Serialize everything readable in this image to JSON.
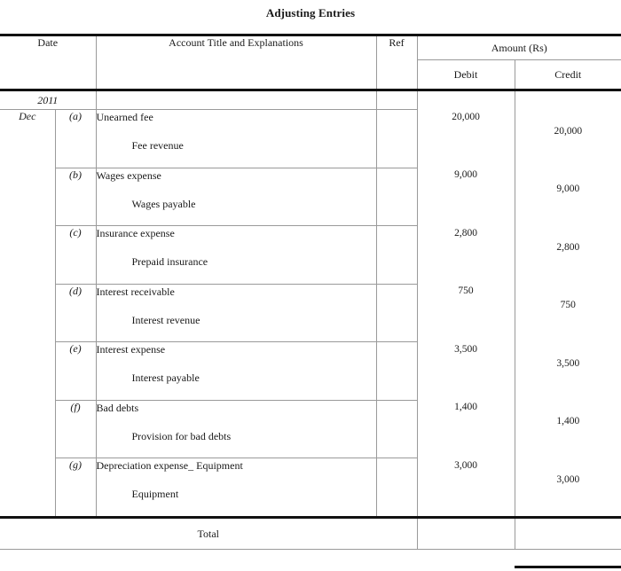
{
  "document": {
    "title": "Adjusting Entries"
  },
  "table": {
    "headers": {
      "date": "Date",
      "account": "Account Title and Explanations",
      "ref": "Ref",
      "amount_group": "Amount (Rs)",
      "debit": "Debit",
      "credit": "Credit"
    },
    "year": "2011",
    "month": "Dec",
    "total_label": "Total",
    "total_debit": "",
    "total_credit": "",
    "entries": [
      {
        "letter": "(a)",
        "debit_account": "Unearned fee",
        "credit_account": "Fee revenue",
        "debit_amount": "20,000",
        "credit_amount": "20,000",
        "ref": ""
      },
      {
        "letter": "(b)",
        "debit_account": "Wages expense",
        "credit_account": "Wages payable",
        "debit_amount": "9,000",
        "credit_amount": "9,000",
        "ref": ""
      },
      {
        "letter": "(c)",
        "debit_account": "Insurance expense",
        "credit_account": "Prepaid insurance",
        "debit_amount": "2,800",
        "credit_amount": "2,800",
        "ref": ""
      },
      {
        "letter": "(d)",
        "debit_account": "Interest receivable",
        "credit_account": "Interest revenue",
        "debit_amount": "750",
        "credit_amount": "750",
        "ref": ""
      },
      {
        "letter": "(e)",
        "debit_account": "Interest expense",
        "credit_account": "Interest payable",
        "debit_amount": "3,500",
        "credit_amount": "3,500",
        "ref": ""
      },
      {
        "letter": "(f)",
        "debit_account": "Bad debts",
        "credit_account": "Provision for bad debts",
        "debit_amount": "1,400",
        "credit_amount": "1,400",
        "ref": ""
      },
      {
        "letter": "(g)",
        "debit_account": "Depreciation expense_ Equipment",
        "credit_account": "Equipment",
        "debit_amount": "3,000",
        "credit_amount": "3,000",
        "ref": ""
      }
    ]
  },
  "colors": {
    "rule_heavy": "#111111",
    "rule_light": "#9a9a9a",
    "text": "#1a1a1a",
    "background": "#ffffff"
  }
}
